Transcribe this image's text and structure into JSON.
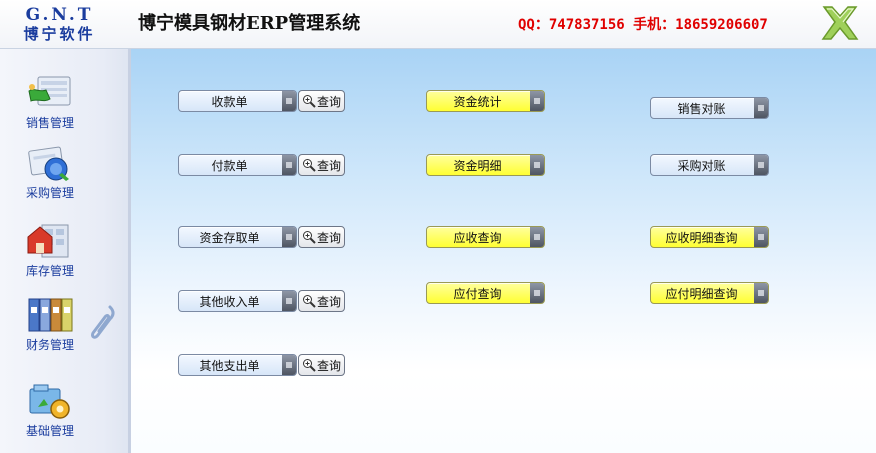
{
  "header": {
    "logo_top": "G.N.T",
    "logo_bottom": "博宁软件",
    "title": "博宁模具钢材ERP管理系统",
    "contact": "QQ：747837156  手机：18659206607"
  },
  "sidebar": {
    "items": [
      {
        "label": "销售管理",
        "icon": "sales-icon"
      },
      {
        "label": "采购管理",
        "icon": "purchase-icon"
      },
      {
        "label": "库存管理",
        "icon": "inventory-icon"
      },
      {
        "label": "财务管理",
        "icon": "finance-icon"
      },
      {
        "label": "基础管理",
        "icon": "settings-icon"
      }
    ]
  },
  "main": {
    "query_label": "查询",
    "col1": [
      "收款单",
      "付款单",
      "资金存取单",
      "其他收入单",
      "其他支出单"
    ],
    "col2": [
      "资金统计",
      "资金明细",
      "应收查询",
      "应付查询"
    ],
    "col3": [
      "销售对账",
      "采购对账",
      "应收明细查询",
      "应付明细查询"
    ]
  },
  "colors": {
    "accent_blue": "#1a3c9e",
    "contact_red": "#e00000",
    "button_yellow": "#ffff33",
    "main_top": "#a9d3f5"
  }
}
